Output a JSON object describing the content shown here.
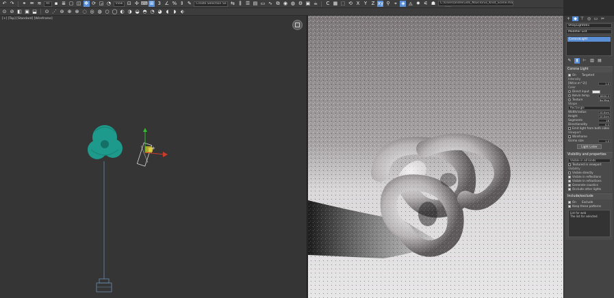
{
  "app": {
    "title_field": "C:\\Users\\andrei\\3ds_Max\\Torus_Knot_Scene.max",
    "toolbar1": {
      "undo_dropdown": "All",
      "selection_set": "Create Selection Se",
      "view_dropdown": "View"
    },
    "toolbar2": {}
  },
  "viewport_left": {
    "label": "[+] [Top] [Standard] [Wireframe]"
  },
  "command_panel": {
    "object_name": "VRayLight001",
    "modifier_list": "Modifier List",
    "stack_item": "CoronaLight",
    "rollouts": [
      {
        "title": "Corona Light",
        "rows": [
          {
            "type": "check",
            "label": "On",
            "on": true,
            "extra": "Targeted"
          },
          {
            "type": "group",
            "label": "Intensity"
          },
          {
            "type": "spin",
            "label": "[W/(sr.m^2)]",
            "value": "1.0"
          },
          {
            "type": "group",
            "label": "Color"
          },
          {
            "type": "radio",
            "label": "Direct input",
            "swatch": true
          },
          {
            "type": "radio",
            "label": "Kelvin temp.",
            "value": "6500.0"
          },
          {
            "type": "radio",
            "label": "Texture",
            "value": "No Map"
          },
          {
            "type": "group",
            "label": "Shape"
          },
          {
            "type": "dropdown",
            "label": "Rectangle"
          },
          {
            "type": "spin",
            "label": "Width/radius",
            "value": "10.0cm"
          },
          {
            "type": "spin",
            "label": "Height",
            "value": "10.0cm"
          },
          {
            "type": "spin",
            "label": "Segments",
            "value": "16"
          },
          {
            "type": "spin",
            "label": "Directionality",
            "value": "0.0"
          },
          {
            "type": "check",
            "label": "Emit light from both sides",
            "on": false
          },
          {
            "type": "group",
            "label": "Viewport"
          },
          {
            "type": "check",
            "label": "Wireframe",
            "on": false
          },
          {
            "type": "spin",
            "label": "Gizmo size",
            "value": "1.0"
          }
        ],
        "button": "Light Lister"
      },
      {
        "title": "Visibility and properties",
        "rows": [
          {
            "type": "dropdown",
            "label": "Visible in all kinds"
          },
          {
            "type": "check",
            "label": "Textured in viewport",
            "on": false
          },
          {
            "type": "group",
            "label": "Visibility"
          },
          {
            "type": "check",
            "label": "Visible directly",
            "on": false
          },
          {
            "type": "check",
            "label": "Visible in reflections",
            "on": true
          },
          {
            "type": "check",
            "label": "Visible in refractions",
            "on": true
          },
          {
            "type": "check",
            "label": "Generate caustics",
            "on": true
          },
          {
            "type": "check",
            "label": "Occlude other lights",
            "on": true
          }
        ]
      },
      {
        "title": "Include/exclude",
        "rows": [
          {
            "type": "check",
            "label": "On",
            "on": true,
            "extra": "Exclude"
          },
          {
            "type": "check",
            "label": "Keep these patterns",
            "on": true
          }
        ],
        "text_lines": [
          "List for web",
          "The list for selected"
        ]
      }
    ]
  },
  "colors": {
    "accent": "#5a8fd6",
    "teal": "#1e9a8c",
    "panel": "#444444",
    "viewport": "#353535"
  }
}
